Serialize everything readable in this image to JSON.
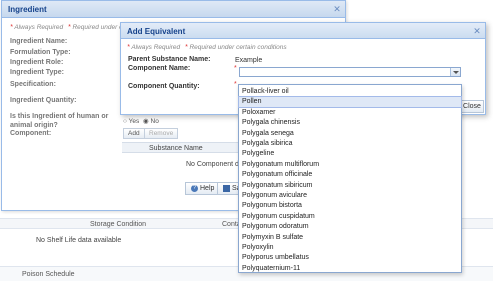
{
  "background": {
    "columns": [
      "Storage Condition",
      "Conta"
    ],
    "empty_text": "No Shelf Life data available",
    "section": "Poison Schedule"
  },
  "ingredient_window": {
    "title": "Ingredient",
    "legend_always": "Always Required",
    "legend_cond": "Required under certain",
    "fields": {
      "name": "Ingredient Name:",
      "formulation": "Formulation Type:",
      "role": "Ingredient Role:",
      "type": "Ingredient Type:",
      "specification": "Specification:",
      "quantity": "Ingredient Quantity:",
      "origin": "Is this Ingredient of human or animal origin?",
      "component": "Component:"
    },
    "origin_yes": "Yes",
    "origin_no": "No",
    "add_button": "Add",
    "remove_button": "Remove",
    "grid_header": "Substance Name",
    "grid_empty": "No Component data",
    "help_button": "Help",
    "save_button": "Save"
  },
  "modal": {
    "title": "Add Equivalent",
    "legend_always": "Always Required",
    "legend_cond": "Required under certain conditions",
    "parent_label": "Parent Substance Name:",
    "parent_value": "Example",
    "component_name_label": "Component Name:",
    "component_quantity_label": "Component Quantity:",
    "component_name_value": "",
    "close_button": "Close"
  },
  "dropdown": {
    "items": [
      "Pollack-liver oil",
      "Pollen",
      "Poloxamer",
      "Polygala chinensis",
      "Polygala senega",
      "Polygala sibirica",
      "Polygeline",
      "Polygonatum multiflorum",
      "Polygonatum officinale",
      "Polygonatum sibiricum",
      "Polygonum aviculare",
      "Polygonum bistorta",
      "Polygonum cuspidatum",
      "Polygonum odoratum",
      "Polymyxin B sulfate",
      "Polyoxylin",
      "Polyporus umbellatus",
      "Polyquaternium-11"
    ],
    "selected": "Pollen"
  },
  "colors": {
    "title_text": "#15428b",
    "border": "#99bbe8",
    "required": "#d33333",
    "selection": "#dfe8f6"
  }
}
